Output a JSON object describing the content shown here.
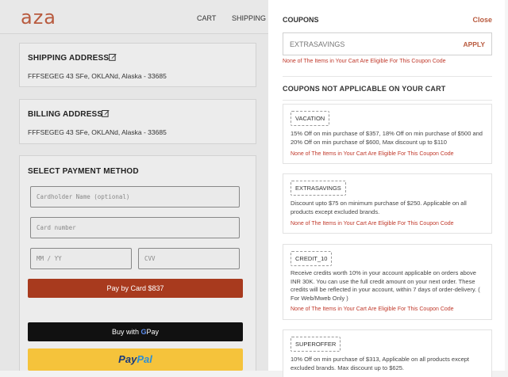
{
  "brand": {
    "logo": "aza"
  },
  "nav": {
    "cart": "CART",
    "shipping": "SHIPPING"
  },
  "shipping": {
    "title": "SHIPPING ADDRESS",
    "address": "FFFSEGEG 43 SFe, OKLANd, Alaska - 33685"
  },
  "billing": {
    "title": "BILLING ADDRESS",
    "address": "FFFSEGEG 43 SFe, OKLANd, Alaska - 33685"
  },
  "payment": {
    "title": "SELECT PAYMENT METHOD",
    "cardholder_placeholder": "Cardholder Name (optional)",
    "card_number_placeholder": "Card number",
    "expiry_placeholder": "MM / YY",
    "cvv_placeholder": "CVV",
    "pay_card_label": "Pay by Card $837",
    "gpay_prefix": "Buy with",
    "gpay_brand_g": "G",
    "gpay_brand_pay": "Pay",
    "paypal_pay": "Pay",
    "paypal_pal": "Pal"
  },
  "coupons": {
    "title": "COUPONS",
    "close": "Close",
    "input_value": "EXTRASAVINGS",
    "apply": "APPLY",
    "input_error": "None of The Items in Your Cart Are Eligible For This Coupon Code",
    "not_applicable_title": "COUPONS NOT APPLICABLE ON YOUR CART",
    "items": [
      {
        "code": "VACATION",
        "description": "15% Off on min purchase of $357, 18% Off on min purchase of $500 and 20% Off on min purchase of $600, Max discount up to $110",
        "error": "None of The Items in Your Cart Are Eligible For This Coupon Code"
      },
      {
        "code": "EXTRASAVINGS",
        "description": "Discount upto $75 on minimum purchase of $250. Applicable on all products except excluded brands.",
        "error": "None of The Items in Your Cart Are Eligible For This Coupon Code"
      },
      {
        "code": "CREDIT_10",
        "description": "Receive credits worth 10% in your account applicable on orders above INR 30K. You can use the full credit amount on your next order. These credits will be reflected in your account, within 7 days of order-delivery. ( For Web/Mweb Only )",
        "error": "None of The Items in Your Cart Are Eligible For This Coupon Code"
      },
      {
        "code": "SUPEROFFER",
        "description": "10% Off on min purchase of $313, Applicable on all products except excluded brands. Max discount up to $625."
      }
    ]
  },
  "colors": {
    "brand": "#b85a3e",
    "pay_card": "#a83a1e",
    "gpay": "#111111",
    "paypal": "#f5c33b",
    "error": "#c0392b"
  }
}
